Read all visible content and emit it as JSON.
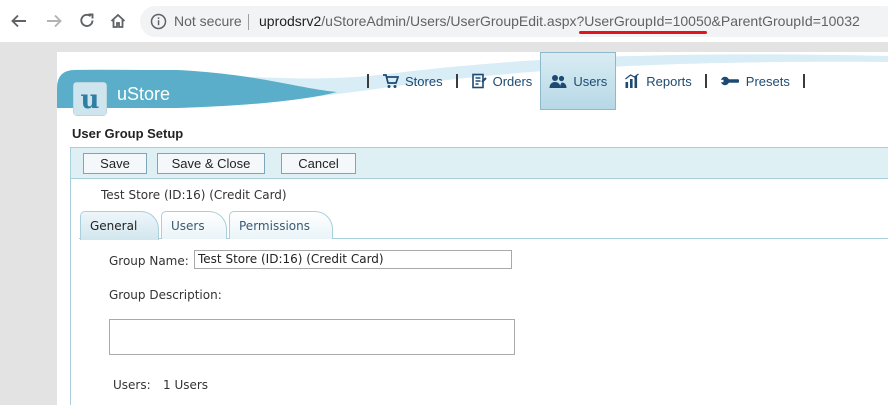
{
  "browser": {
    "security_label": "Not secure",
    "url_host": "uprodsrv2",
    "url_rest": "/uStoreAdmin/Users/UserGroupEdit.aspx?UserGroupId=10050&ParentGroupId=10032"
  },
  "app": {
    "brand": "uStore",
    "logo_letter": "u",
    "menu": [
      {
        "label": "Stores",
        "icon": "cart-icon"
      },
      {
        "label": "Orders",
        "icon": "orders-icon"
      },
      {
        "label": "Users",
        "icon": "users-icon",
        "active": true
      },
      {
        "label": "Reports",
        "icon": "chart-icon"
      },
      {
        "label": "Presets",
        "icon": "wrench-icon"
      }
    ]
  },
  "page": {
    "title": "User Group Setup",
    "toolbar": {
      "save": "Save",
      "save_close": "Save & Close",
      "cancel": "Cancel"
    },
    "store_line": "Test Store (ID:16) (Credit Card)",
    "tabs": [
      {
        "label": "General",
        "active": true
      },
      {
        "label": "Users"
      },
      {
        "label": "Permissions"
      }
    ],
    "form": {
      "group_name_label": "Group Name:",
      "group_name_value": "Test Store (ID:16) (Credit Card)",
      "group_description_label": "Group Description:",
      "group_description_value": "",
      "users_label": "Users:",
      "users_value": "1 Users"
    }
  },
  "colors": {
    "header_teal": "#5aaec9",
    "highlight_red": "#e0141e"
  }
}
